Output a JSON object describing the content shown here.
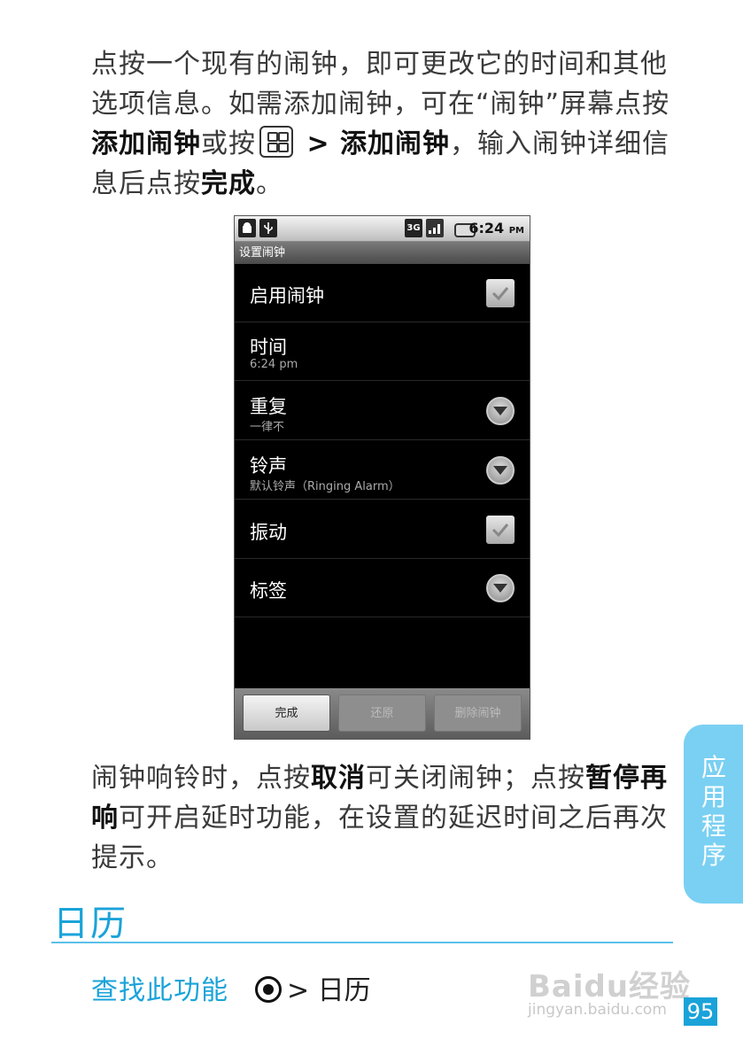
{
  "para1": {
    "t1": "点按一个现有的闹钟，即可更改它的时间和其他选项信息。如需添加闹钟，可在“闹钟”屏幕点按",
    "b1": "添加闹钟",
    "t2": "或按",
    "t3": " > ",
    "b2": "添加闹钟",
    "t4": "，输入闹钟详细信息后点按",
    "b3": "完成",
    "t5": "。"
  },
  "phone": {
    "status_time": "6:24",
    "status_ampm": "PM",
    "status_3g": "3G",
    "title": "设置闹钟",
    "rows": [
      {
        "label": "启用闹钟",
        "sub": ""
      },
      {
        "label": "时间",
        "sub": "6:24 pm"
      },
      {
        "label": "重复",
        "sub": "一律不"
      },
      {
        "label": "铃声",
        "sub": "默认铃声（Ringing Alarm）"
      },
      {
        "label": "振动",
        "sub": ""
      },
      {
        "label": "标签",
        "sub": ""
      }
    ],
    "buttons": [
      "完成",
      "还原",
      "删除闹钟"
    ]
  },
  "para2": {
    "t1": "闹钟响铃时，点按",
    "b1": "取消",
    "t2": "可关闭闹钟；点按",
    "b2": "暂停再响",
    "t3": "可开启延时功能，在设置的延迟时间之后再次提示。"
  },
  "section": {
    "title": "日历",
    "find_label": "查找此功能",
    "find_path": "> 日历"
  },
  "side_tab": "应用程序",
  "page_number": "95",
  "watermark": {
    "top": "Baidu经验",
    "bottom": "jingyan.baidu.com"
  },
  "colors": {
    "accent": "#1aa3d9",
    "tab": "#7ad0f2"
  }
}
